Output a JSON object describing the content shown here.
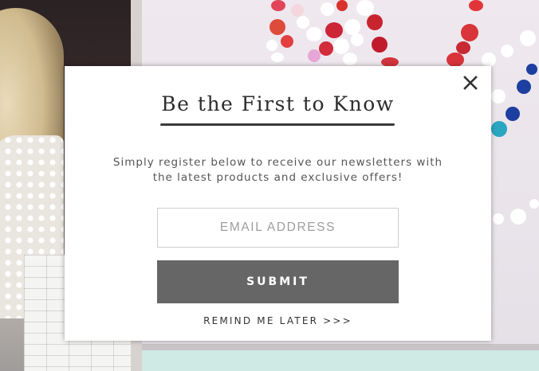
{
  "modal": {
    "title": "Be the First to Know",
    "description_line1": "Simply register below to receive our newsletters with",
    "description_line2": "the latest products and exclusive offers!",
    "email_placeholder": "EMAIL ADDRESS",
    "email_value": "",
    "submit_label": "SUBMIT",
    "remind_label": "REMIND ME LATER >>>",
    "close_icon": "close-icon"
  },
  "colors": {
    "submit_bg": "#666666",
    "title_text": "#2d2d2d",
    "modal_bg": "#ffffff"
  }
}
